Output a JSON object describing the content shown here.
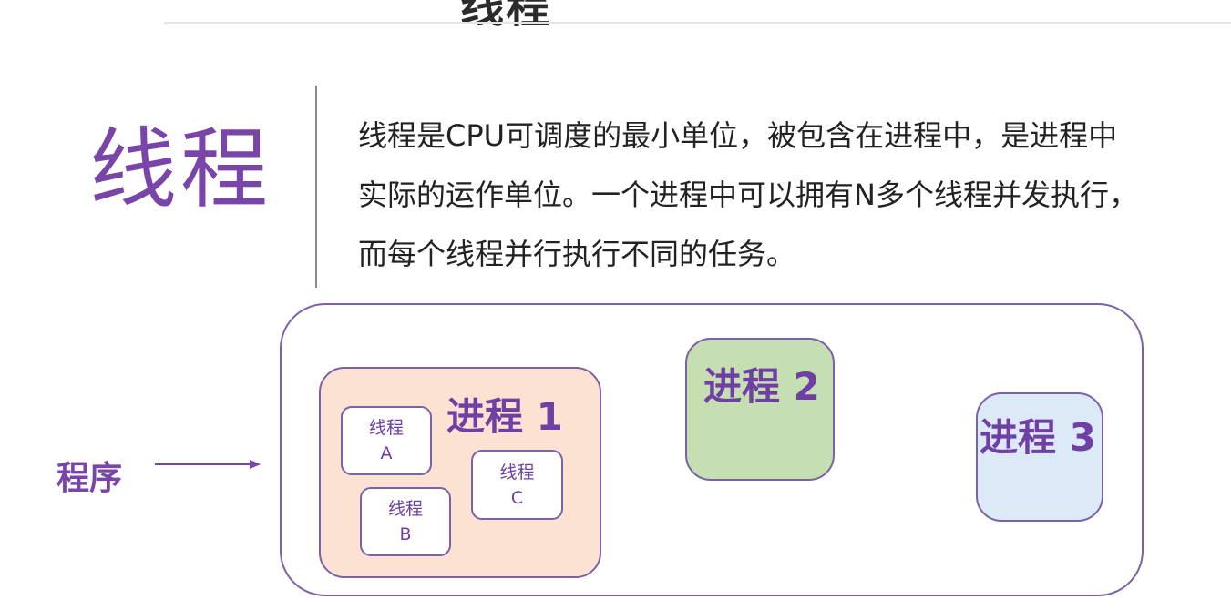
{
  "header": {
    "title": "线程"
  },
  "intro": {
    "heading": "线程",
    "lines": [
      "线程是CPU可调度的最小单位，被包含在进程中，是进程中",
      "实际的运作单位。一个进程中可以拥有N多个线程并发执行，",
      "而每个线程并行执行不同的任务。"
    ]
  },
  "diagram": {
    "program_label": "程序",
    "processes": [
      {
        "label": "进程 1",
        "color": "#fce2d3"
      },
      {
        "label": "进程 2",
        "color": "#c6dfb2"
      },
      {
        "label": "进程 3",
        "color": "#dceaf7"
      }
    ],
    "threads": [
      {
        "name": "线程",
        "id": "A"
      },
      {
        "name": "线程",
        "id": "B"
      },
      {
        "name": "线程",
        "id": "C"
      }
    ],
    "accent_color": "#7a45a8",
    "border_color": "#7c61a8"
  }
}
